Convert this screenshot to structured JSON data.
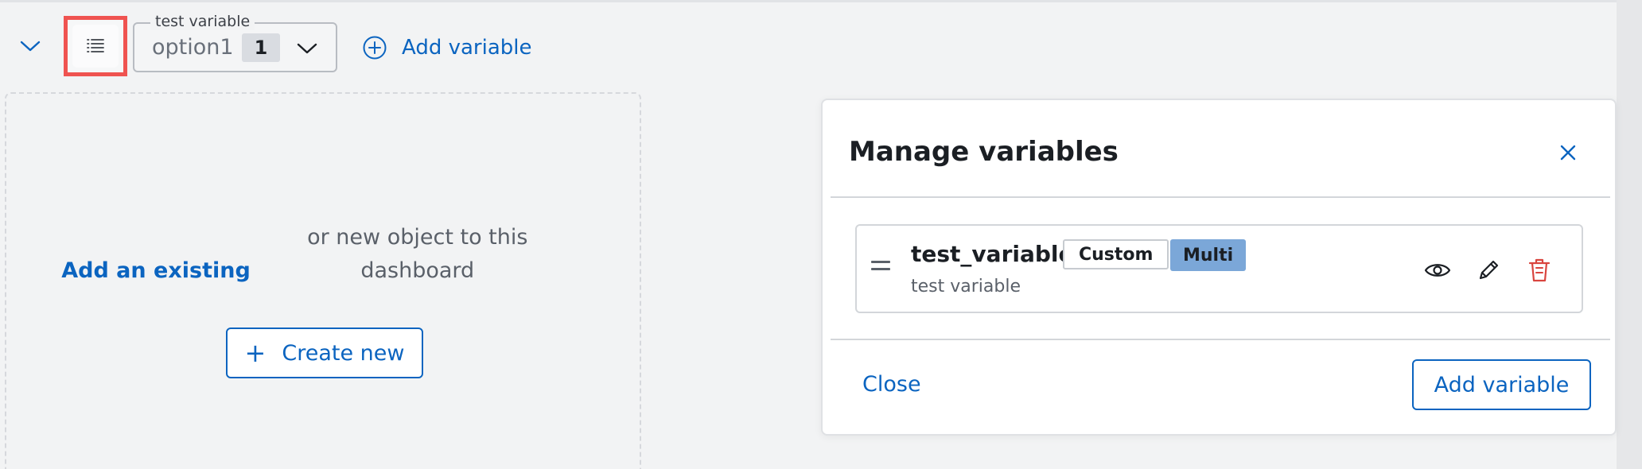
{
  "toolbar": {
    "collapse_icon": "chevron-down-icon",
    "manage_icon": "list-icon",
    "variable": {
      "label": "test variable",
      "value": "option1",
      "count": "1",
      "dropdown_icon": "chevron-down-icon"
    },
    "add_variable_label": "Add variable",
    "add_variable_icon": "plus-circle-icon"
  },
  "empty_state": {
    "link_text": "Add an existing",
    "text_rest": " or new object to this dashboard",
    "create_label": "Create new"
  },
  "modal": {
    "title": "Manage variables",
    "close_icon": "close-icon",
    "variables": [
      {
        "name": "test_variable",
        "type_badge": "Custom",
        "multi_badge": "Multi",
        "description": "test variable",
        "actions": [
          "eye-icon",
          "pencil-icon",
          "trash-icon"
        ]
      }
    ],
    "close_label": "Close",
    "add_label": "Add variable"
  },
  "colors": {
    "accent": "#0b64c0",
    "highlight_border": "#ef5350",
    "multi_badge_bg": "#7ba7d8",
    "danger": "#d9453f",
    "background": "#f2f3f4"
  }
}
